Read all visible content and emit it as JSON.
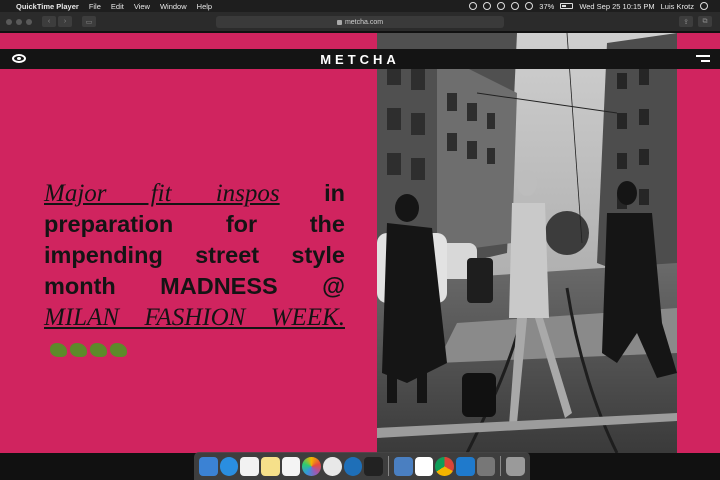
{
  "menubar": {
    "app_name": "QuickTime Player",
    "menus": [
      "File",
      "Edit",
      "View",
      "Window",
      "Help"
    ],
    "battery": "37%",
    "datetime": "Wed Sep 25  10:15 PM",
    "user": "Luis Krotz"
  },
  "browser": {
    "url": "metcha.com"
  },
  "site": {
    "logo": "METCHA",
    "headline": {
      "link1": "Major fit inspos",
      "text1": " in preparation for the impending street style month MADNESS @ ",
      "link2": "MILAN FASHION WEEK.",
      "emojis": [
        "dragon-emoji",
        "snake-emoji",
        "lizard-emoji",
        "dinosaur-emoji"
      ]
    },
    "photo": "street-style-black-and-white-photo"
  },
  "dock": {
    "apps": [
      "finder",
      "safari",
      "calendar",
      "notes",
      "reminders",
      "photos",
      "itunes",
      "quicktime",
      "terminal",
      "preview",
      "slack",
      "chrome",
      "vscode",
      "system-preferences",
      "trash"
    ]
  },
  "colors": {
    "page_bg": "#d0245f",
    "header_bg": "#141414",
    "text": "#141414"
  }
}
